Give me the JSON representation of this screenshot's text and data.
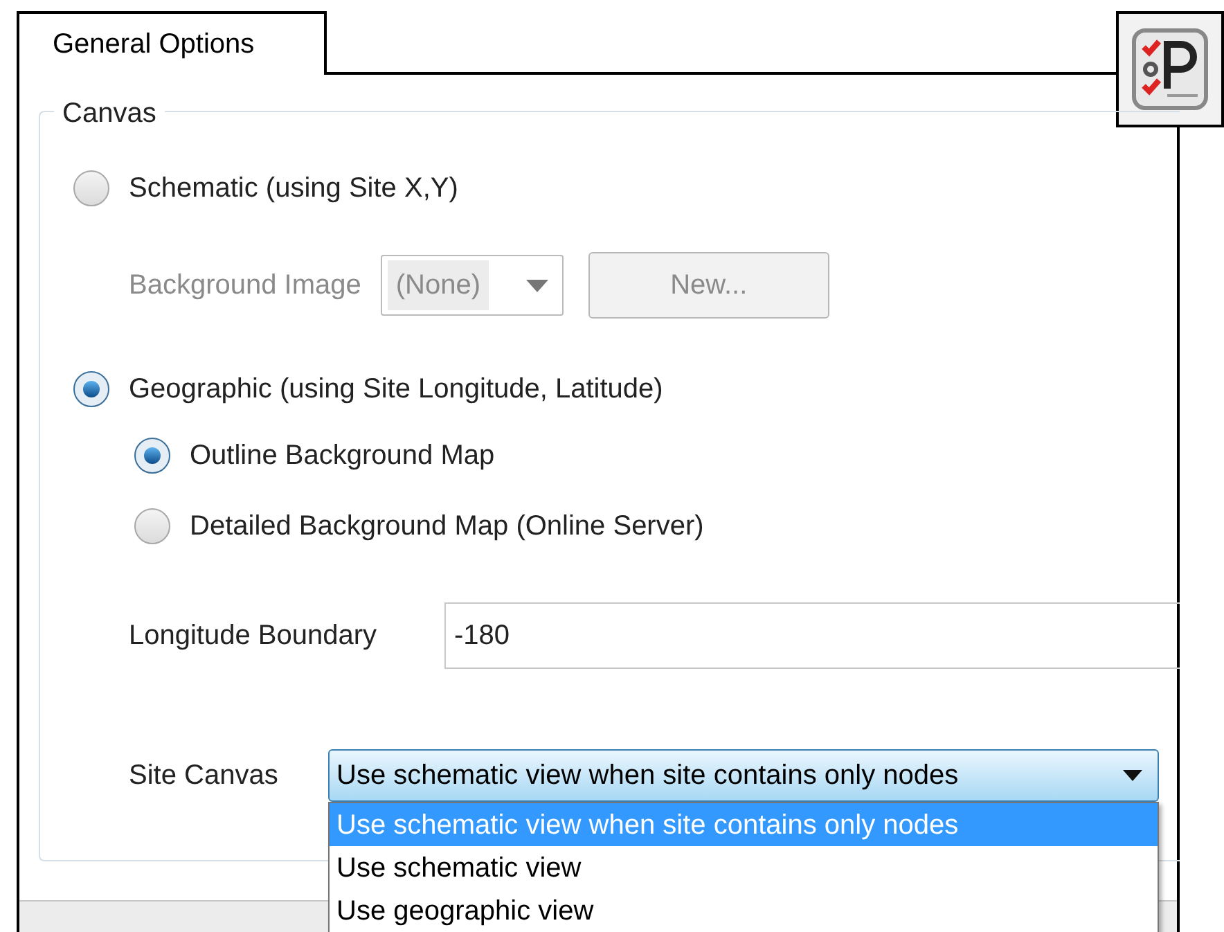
{
  "tabs": [
    {
      "label": "General Options",
      "selected": true
    }
  ],
  "canvas": {
    "title": "Canvas",
    "schematic": {
      "label": "Schematic (using Site X,Y)",
      "selected": false
    },
    "background_image": {
      "label": "Background Image",
      "value": "(None)",
      "button": "New...",
      "disabled": true
    },
    "geographic": {
      "label": "Geographic (using Site Longitude, Latitude)",
      "selected": true,
      "map_options": [
        {
          "label": "Outline Background Map",
          "selected": true
        },
        {
          "label": "Detailed Background Map (Online Server)",
          "selected": false
        }
      ]
    },
    "longitude_boundary": {
      "label": "Longitude Boundary",
      "value": "-180"
    },
    "site_canvas": {
      "label": "Site Canvas",
      "value": "Use schematic view when site contains only nodes",
      "expanded": true,
      "options": [
        {
          "label": "Use schematic view when site contains only nodes",
          "selected": true
        },
        {
          "label": "Use schematic view",
          "selected": false
        },
        {
          "label": "Use geographic view",
          "selected": false
        }
      ]
    }
  }
}
